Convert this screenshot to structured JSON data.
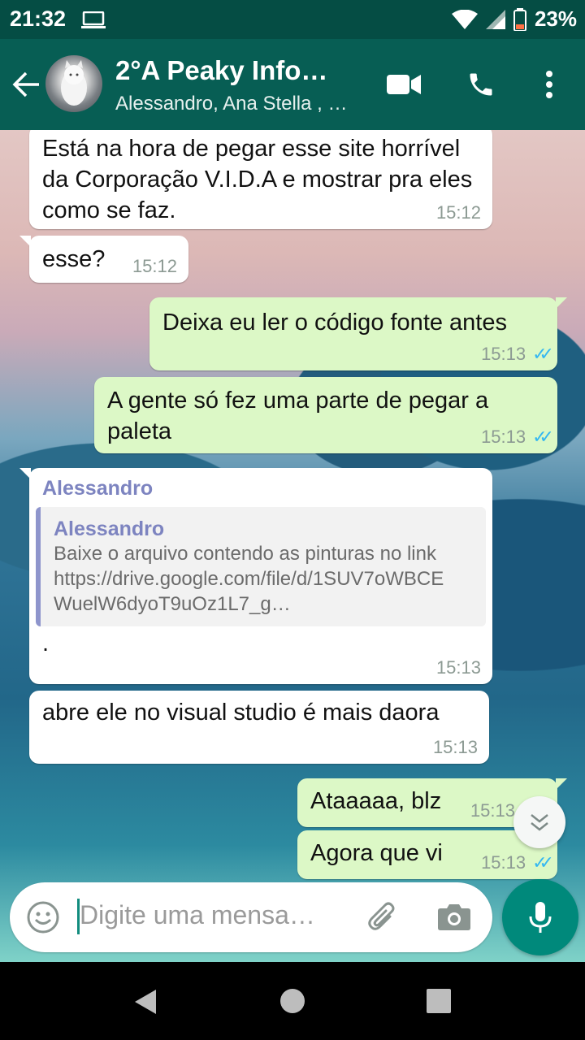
{
  "status_bar": {
    "time": "21:32",
    "battery": "23%"
  },
  "header": {
    "title": "2°A Peaky Info…",
    "subtitle": "Alessandro, Ana Stella , …"
  },
  "messages": [
    {
      "direction": "in",
      "text": "Está na hora de pegar esse site horrível da Corporação V.I.D.A e mostrar pra eles como se faz.",
      "time": "15:12"
    },
    {
      "direction": "in",
      "text": "esse?",
      "time": "15:12"
    },
    {
      "direction": "out",
      "text": "Deixa eu ler o código fonte antes",
      "time": "15:13"
    },
    {
      "direction": "out",
      "text": "A gente só fez uma parte de pegar a paleta",
      "time": "15:13"
    },
    {
      "direction": "in",
      "sender": "Alessandro",
      "quote": {
        "sender": "Alessandro",
        "text": "Baixe o arquivo contendo as pinturas no link https://drive.google.com/file/d/1SUV7oWBCEWuelW6dyoT9uOz1L7_g…"
      },
      "text": ".",
      "time": "15:13"
    },
    {
      "direction": "in",
      "text": "abre ele no visual studio é mais daora",
      "time": "15:13"
    },
    {
      "direction": "out",
      "text": "Ataaaaa, blz",
      "time": "15:13"
    },
    {
      "direction": "out",
      "text": "Agora que vi",
      "time": "15:13"
    }
  ],
  "composer": {
    "placeholder": "Digite uma mensa…"
  },
  "icons": {
    "back": "arrow-left-icon",
    "video": "video-call-icon",
    "call": "phone-icon",
    "menu": "more-vert-icon",
    "emoji": "emoji-icon",
    "attach": "paperclip-icon",
    "camera": "camera-icon",
    "mic": "mic-icon",
    "scroll": "double-chevron-down-icon"
  },
  "colors": {
    "header": "#075e54",
    "status_bar": "#054d44",
    "outgoing": "#dcf8c6",
    "incoming": "#ffffff",
    "accent": "#00897b",
    "read_ticks": "#34b7f1"
  }
}
